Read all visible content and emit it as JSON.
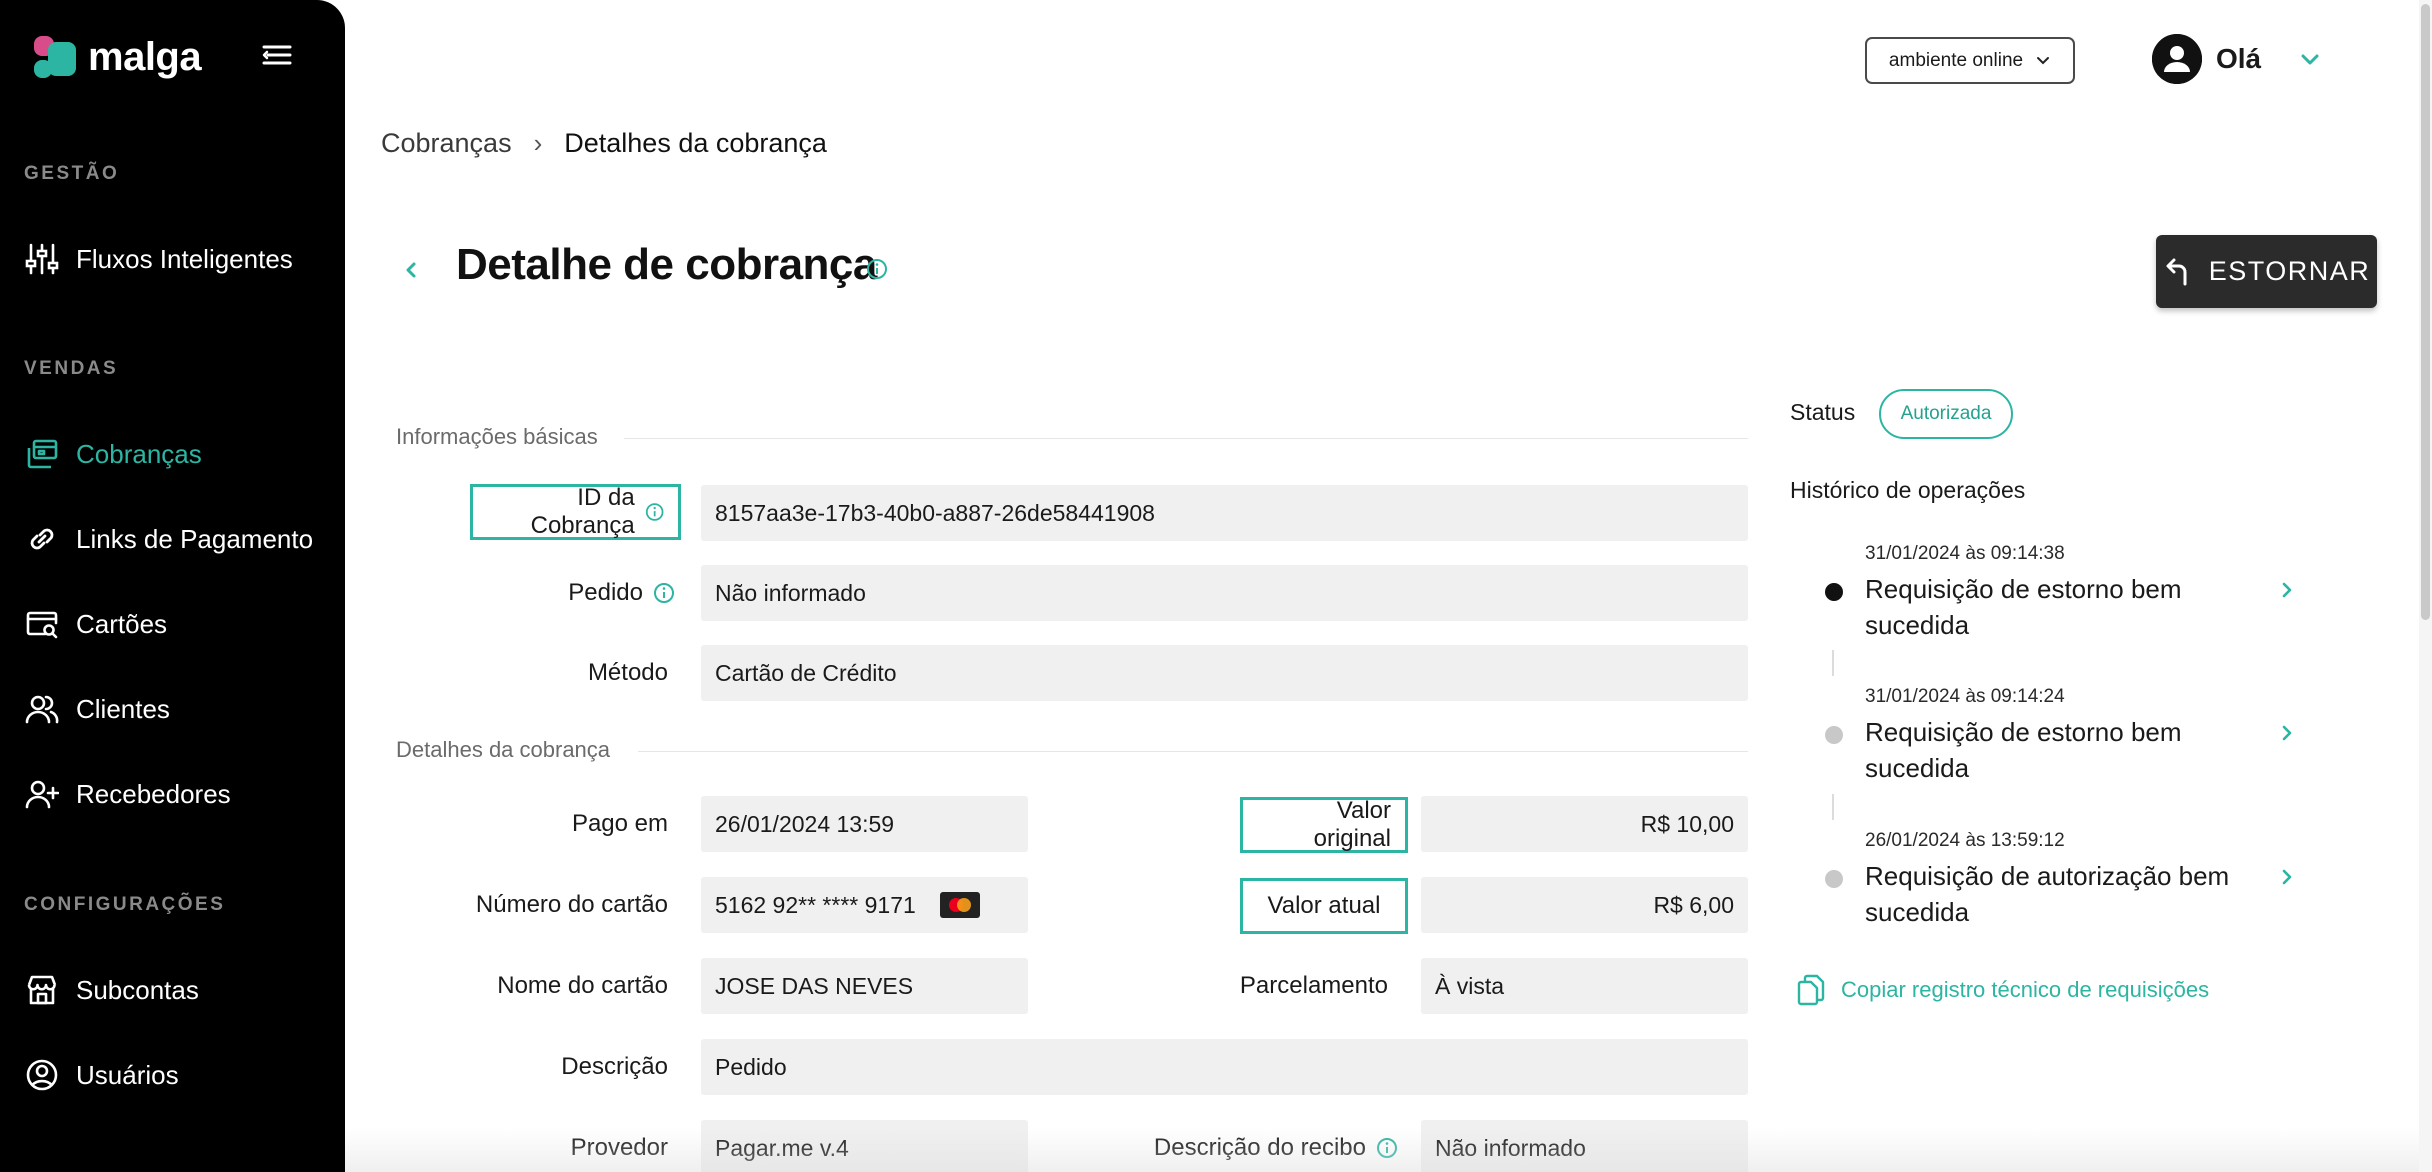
{
  "app": {
    "name": "malga"
  },
  "sidebar": {
    "sections": [
      {
        "label": "GESTÃO"
      },
      {
        "label": "VENDAS"
      },
      {
        "label": "CONFIGURAÇÕES"
      }
    ],
    "items": [
      {
        "label": "Fluxos Inteligentes",
        "icon": "sliders-icon"
      },
      {
        "label": "Cobranças",
        "icon": "charges-icon",
        "active": true
      },
      {
        "label": "Links de Pagamento",
        "icon": "link-icon"
      },
      {
        "label": "Cartões",
        "icon": "card-search-icon"
      },
      {
        "label": "Clientes",
        "icon": "users-icon"
      },
      {
        "label": "Recebedores",
        "icon": "user-plus-icon"
      },
      {
        "label": "Subcontas",
        "icon": "store-icon"
      },
      {
        "label": "Usuários",
        "icon": "user-circle-icon"
      }
    ]
  },
  "topbar": {
    "environment": "ambiente online",
    "greeting": "Olá"
  },
  "breadcrumb": {
    "parent": "Cobranças",
    "separator": "›",
    "current": "Detalhes da cobrança"
  },
  "page": {
    "title": "Detalhe de cobrança",
    "refund_label": "ESTORNAR"
  },
  "basic_info": {
    "section_title": "Informações básicas",
    "fields": [
      {
        "label": "ID da Cobrança",
        "value": "8157aa3e-17b3-40b0-a887-26de58441908"
      },
      {
        "label": "Pedido",
        "value": "Não informado"
      },
      {
        "label": "Método",
        "value": "Cartão de Crédito"
      }
    ]
  },
  "charge_details": {
    "section_title": "Detalhes da cobrança",
    "paid_at": {
      "label": "Pago em",
      "value": "26/01/2024 13:59"
    },
    "card_number": {
      "label": "Número do cartão",
      "value": "5162 92** **** 9171"
    },
    "card_name": {
      "label": "Nome do cartão",
      "value": "JOSE DAS NEVES"
    },
    "description": {
      "label": "Descrição",
      "value": "Pedido"
    },
    "provider": {
      "label": "Provedor",
      "value": "Pagar.me v.4"
    },
    "original_amount": {
      "label": "Valor original",
      "value": "R$ 10,00"
    },
    "current_amount": {
      "label": "Valor atual",
      "value": "R$ 6,00"
    },
    "installments": {
      "label": "Parcelamento",
      "value": "À vista"
    },
    "receipt_description": {
      "label": "Descrição do recibo",
      "value": "Não informado"
    }
  },
  "status": {
    "label": "Status",
    "value": "Autorizada",
    "color": "#2cb5a3"
  },
  "history": {
    "title": "Histórico de operações",
    "items": [
      {
        "date": "31/01/2024 às 09:14:38",
        "text": "Requisição de estorno bem sucedida",
        "dot_color": "#111111"
      },
      {
        "date": "31/01/2024 às 09:14:24",
        "text": "Requisição de estorno bem sucedida",
        "dot_color": "#c8c8c8"
      },
      {
        "date": "26/01/2024 às 13:59:12",
        "text": "Requisição de autorização bem sucedida",
        "dot_color": "#c8c8c8"
      }
    ],
    "copy_label": "Copiar registro técnico de requisições"
  },
  "colors": {
    "accent": "#2cb5a3",
    "sidebar_bg": "#000000",
    "brand_pink": "#d94c8a"
  }
}
